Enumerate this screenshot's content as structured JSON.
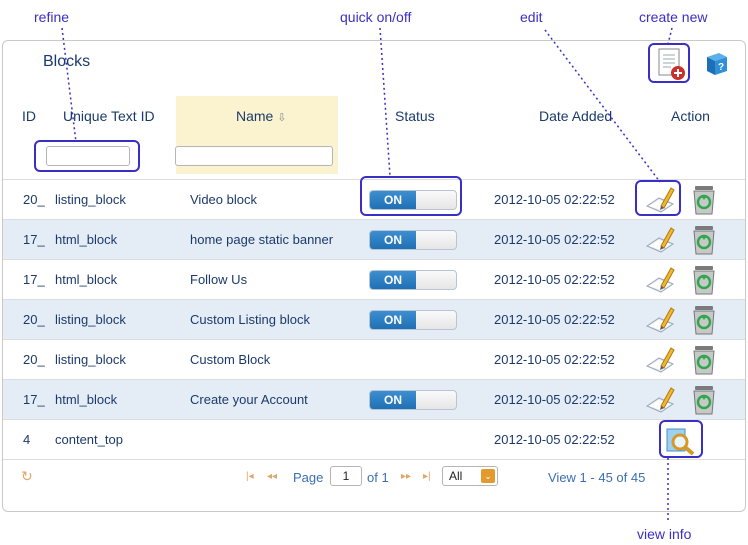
{
  "callouts": {
    "refine": "refine",
    "quick": "quick on/off",
    "edit": "edit",
    "create": "create new",
    "view": "view info"
  },
  "panel": {
    "title": "Blocks"
  },
  "columns": {
    "id": "ID",
    "uid": "Unique Text ID",
    "name": "Name",
    "status": "Status",
    "date": "Date Added",
    "action": "Action"
  },
  "filters": {
    "uid_value": "",
    "name_value": ""
  },
  "rows": [
    {
      "id": "20_",
      "uid": "listing_block",
      "name": "Video block",
      "status": "ON",
      "date": "2012-10-05 02:22:52"
    },
    {
      "id": "17_",
      "uid": "html_block",
      "name": "home page static banner",
      "status": "ON",
      "date": "2012-10-05 02:22:52"
    },
    {
      "id": "17_",
      "uid": "html_block",
      "name": "Follow Us",
      "status": "ON",
      "date": "2012-10-05 02:22:52"
    },
    {
      "id": "20_",
      "uid": "listing_block",
      "name": "Custom Listing block",
      "status": "ON",
      "date": "2012-10-05 02:22:52"
    },
    {
      "id": "20_",
      "uid": "listing_block",
      "name": "Custom Block",
      "status": "",
      "date": "2012-10-05 02:22:52"
    },
    {
      "id": "17_",
      "uid": "html_block",
      "name": "Create your Account",
      "status": "ON",
      "date": "2012-10-05 02:22:52"
    },
    {
      "id": "4",
      "uid": "content_top",
      "name": "",
      "status": "",
      "date": "2012-10-05 02:22:52"
    }
  ],
  "pager": {
    "page_label": "Page",
    "page_value": "1",
    "of_label": "of 1",
    "rows_select": "All",
    "view_info": "View 1 - 45 of 45"
  },
  "colors": {
    "accent": "#3a2fc4",
    "toggle_on": "#1f6fb5",
    "alt_row": "#e4ecf6",
    "name_col": "#fbf3cf"
  },
  "icons": [
    "refresh-icon",
    "create-new-icon",
    "help-book-icon",
    "edit-icon",
    "delete-recycle-icon",
    "view-info-icon",
    "sort-arrow-icon"
  ]
}
